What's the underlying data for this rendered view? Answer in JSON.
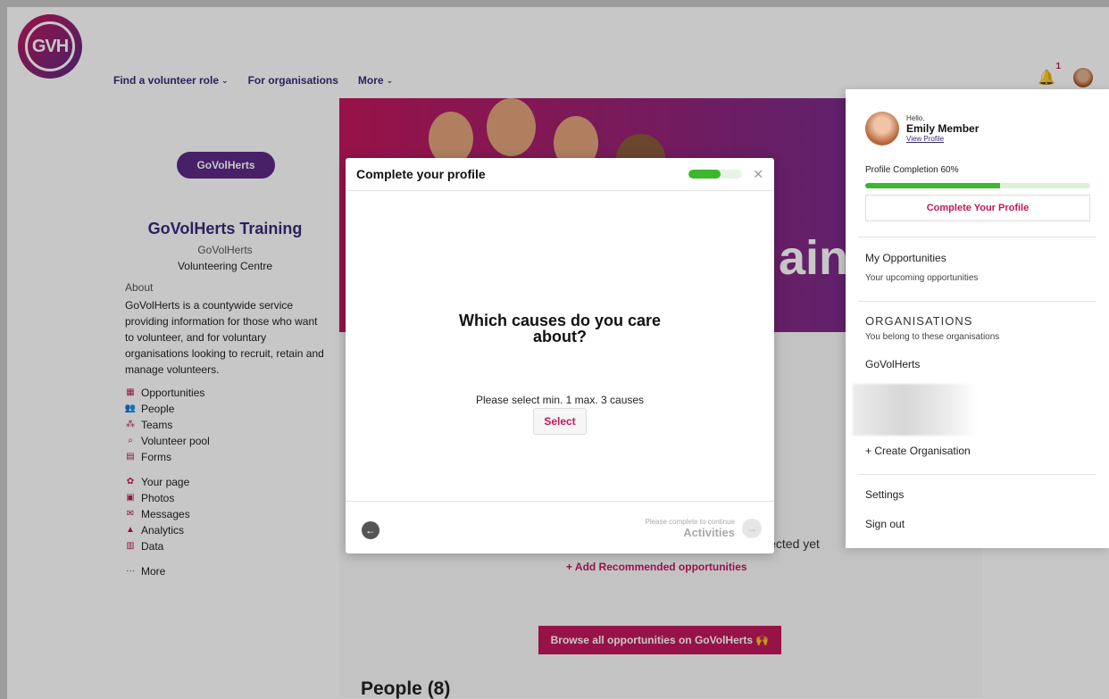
{
  "header": {
    "logo_text": "GVH",
    "nav": [
      {
        "label": "Find a volunteer role",
        "has_dropdown": true
      },
      {
        "label": "For organisations",
        "has_dropdown": false
      },
      {
        "label": "More",
        "has_dropdown": true
      }
    ],
    "notifications_count": "1"
  },
  "sidebar": {
    "org_logo_text": "GoVolHerts",
    "org_name": "GoVolHerts Training",
    "parent_org": "GoVolHerts",
    "org_type": "Volunteering Centre",
    "about_label": "About",
    "about_text": "GoVolHerts is a countywide service providing information for those who want to volunteer, and for voluntary organisations looking to recruit, retain and manage volunteers.",
    "menu_primary": [
      {
        "label": "Opportunities",
        "icon": "calendar-icon"
      },
      {
        "label": "People",
        "icon": "people-icon"
      },
      {
        "label": "Teams",
        "icon": "teams-icon"
      },
      {
        "label": "Volunteer pool",
        "icon": "search-icon"
      },
      {
        "label": "Forms",
        "icon": "forms-icon"
      }
    ],
    "menu_secondary": [
      {
        "label": "Your page",
        "icon": "gear-icon"
      },
      {
        "label": "Photos",
        "icon": "photos-icon"
      },
      {
        "label": "Messages",
        "icon": "messages-icon"
      },
      {
        "label": "Analytics",
        "icon": "analytics-icon"
      },
      {
        "label": "Data",
        "icon": "data-icon"
      }
    ],
    "more_label": "More"
  },
  "main": {
    "banner_text": "ain",
    "not_selected_text": "lected yet",
    "add_recommended": "+ Add Recommended opportunities",
    "browse_button": "Browse all opportunities on GoVolHerts 🙌",
    "people_heading": "People (8)"
  },
  "modal": {
    "title": "Complete your profile",
    "progress": 0.6,
    "question_line1": "Which causes do you care",
    "question_line2": "about?",
    "instruction": "Please select min. 1 max. 3 causes",
    "select_label": "Select",
    "next_hint": "Please complete to continue",
    "next_label": "Activities"
  },
  "profile_panel": {
    "greeting": "Hello,",
    "user_name": "Emily Member",
    "view_profile": "View Profile",
    "completion_label": "Profile Completion 60%",
    "completion": 0.6,
    "complete_button": "Complete Your Profile",
    "my_opportunities": "My Opportunities",
    "my_opportunities_sub": "Your upcoming opportunities",
    "organisations_heading": "ORGANISATIONS",
    "organisations_sub": "You belong to these organisations",
    "organisation_item": "GoVolHerts",
    "create_org": "+ Create Organisation",
    "settings": "Settings",
    "sign_out": "Sign out"
  },
  "colors": {
    "brand_pink": "#c2185b",
    "brand_purple": "#3a2a78",
    "progress_green": "#3cb72e"
  }
}
